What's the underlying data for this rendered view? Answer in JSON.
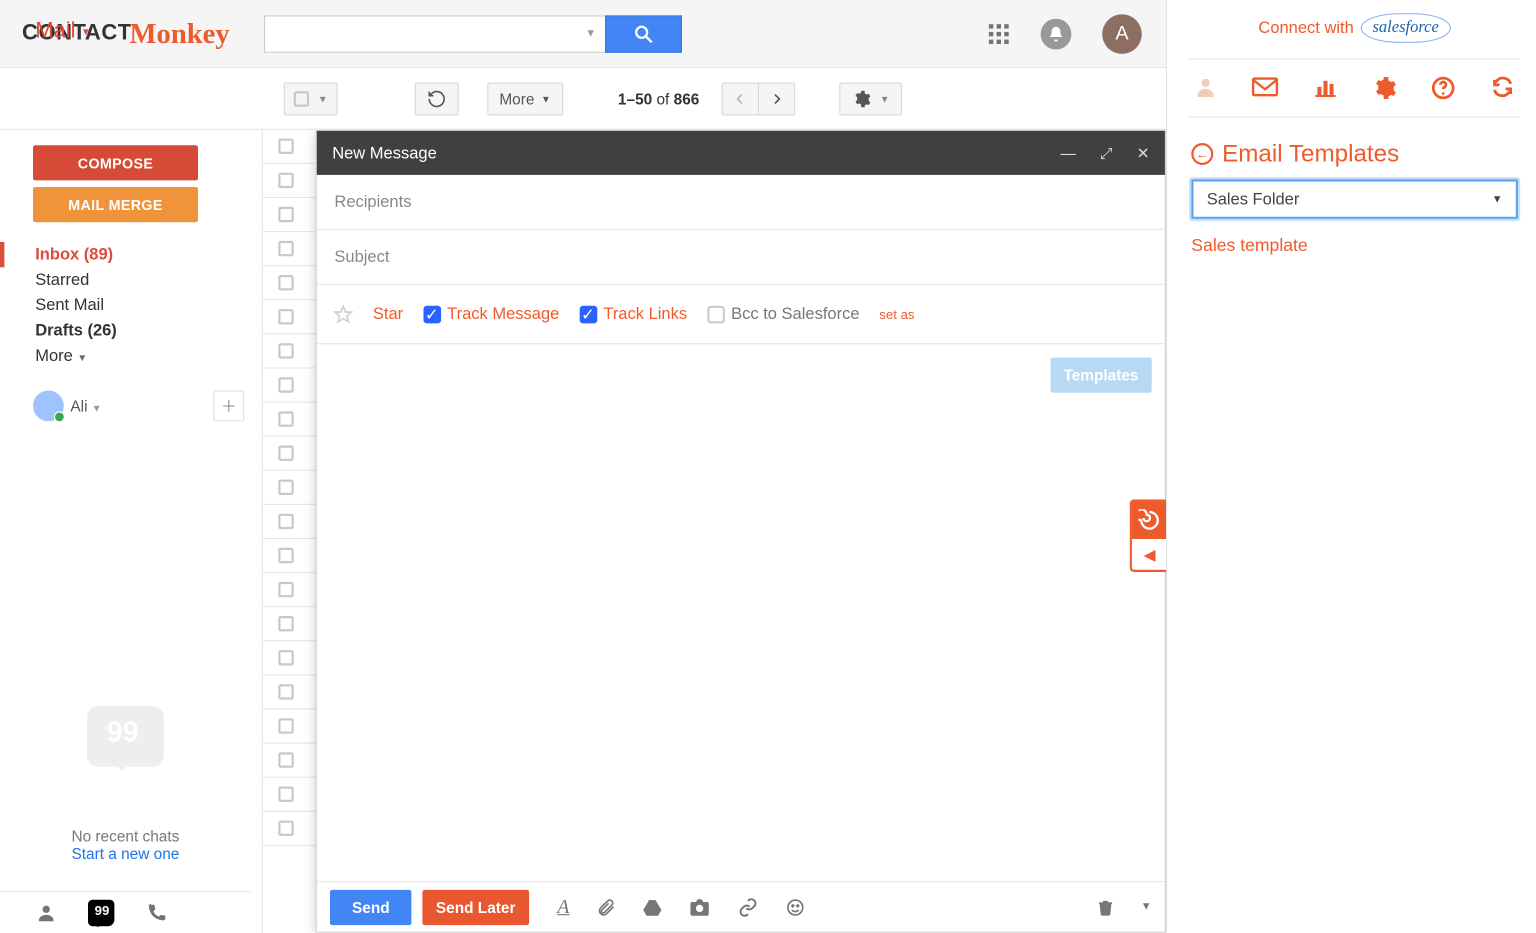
{
  "logo": {
    "word1": "CONTACT",
    "word2": "Monkey"
  },
  "header": {
    "avatar_initial": "A"
  },
  "toolbar": {
    "more_label": "More",
    "range_start": "1",
    "range_end": "50",
    "of_word": "of",
    "total": "866"
  },
  "mail_switch": "Mail",
  "compose_btn": "COMPOSE",
  "merge_btn": "MAIL MERGE",
  "folders": {
    "inbox": "Inbox (89)",
    "starred": "Starred",
    "sent": "Sent Mail",
    "drafts": "Drafts (26)",
    "more": "More"
  },
  "chat_user": "Ali",
  "no_chat": "No recent chats",
  "start_chat": "Start a new one",
  "compose": {
    "title": "New Message",
    "recipients_ph": "Recipients",
    "subject_ph": "Subject",
    "star": "Star",
    "track_msg": "Track Message",
    "track_links": "Track Links",
    "bcc_sf": "Bcc to Salesforce",
    "set_as": "set as",
    "templates": "Templates",
    "send": "Send",
    "send_later": "Send Later"
  },
  "cm_panel": {
    "connect_with": "Connect with",
    "sf_word": "salesforce",
    "section_title": "Email Templates",
    "select_value": "Sales Folder",
    "template_link": "Sales template"
  }
}
